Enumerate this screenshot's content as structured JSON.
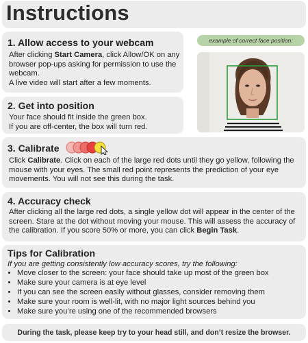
{
  "title": "Instructions",
  "step1": {
    "heading": "1. Allow access to your webcam",
    "text_a": "After clicking ",
    "start_camera": "Start Camera",
    "text_b": ", click Allow/OK on any browser pop-ups asking for permission to use the webcam.",
    "text_c": "A live video will start after a few moments."
  },
  "example_caption": "example of correct face position:",
  "step2": {
    "heading": "2. Get into position",
    "line1": "Your face should fit inside the green box.",
    "line2": "If you are off-center, the box will turn red."
  },
  "step3": {
    "heading": "3. Calibrate",
    "text_a": "Click ",
    "calibrate": "Calibrate",
    "text_b": ". Click on each of the large red dots until they go yellow, following the mouse with your eyes. The small red point represents the prediction of your eye movements. You will not see this during the task."
  },
  "step4": {
    "heading": "4. Accuracy check",
    "text_a": "After clicking all the large red dots, a single yellow dot will appear in the center of the screen. Stare at the dot without moving your mouse. This will assess the accuracy of the calibration. If you score 50% or more, you can click ",
    "begin_task": "Begin Task",
    "text_b": "."
  },
  "tips": {
    "heading": "Tips for Calibration",
    "intro": "If you are getting consistently low accuracy scores, try the following:",
    "items": [
      "Move closer to the screen: your face should take up most of the green box",
      "Make sure your camera is at eye level",
      "If you can see the screen easily without glasses, consider removing them",
      "Make sure your room is well-lit, with no major light sources behind you",
      "Make sure you’re using one of the recommended browsers"
    ]
  },
  "footer": "During the task, please keep try to your head still, and don’t resize the browser.",
  "colors": {
    "panel": "#ececec",
    "pill": "#b7d3a8",
    "face_box": "#2e9b3a",
    "dot_red": "#e8403c",
    "dot_yellow": "#f5e13a"
  },
  "icons": [
    "calibration-dots-icon",
    "mouse-cursor-icon"
  ]
}
